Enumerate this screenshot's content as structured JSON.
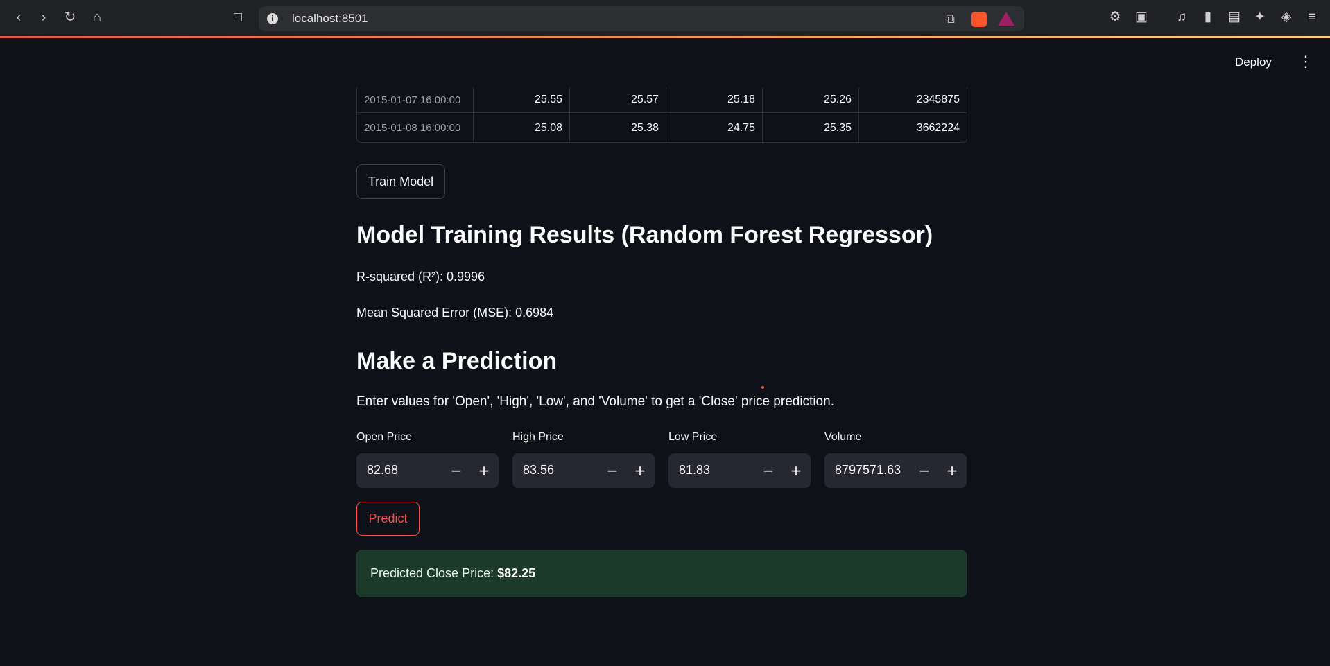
{
  "browser": {
    "url": "localhost:8501"
  },
  "header": {
    "deploy_label": "Deploy"
  },
  "table": {
    "rows": [
      {
        "index": "2015-01-07 16:00:00",
        "cells": [
          "25.55",
          "25.57",
          "25.18",
          "25.26",
          "2345875"
        ]
      },
      {
        "index": "2015-01-08 16:00:00",
        "cells": [
          "25.08",
          "25.38",
          "24.75",
          "25.35",
          "3662224"
        ]
      }
    ]
  },
  "train_button_label": "Train Model",
  "results": {
    "title": "Model Training Results (Random Forest Regressor)",
    "r2_text": "R-squared (R²): 0.9996",
    "mse_text": "Mean Squared Error (MSE): 0.6984"
  },
  "prediction": {
    "title": "Make a Prediction",
    "intro": "Enter values for 'Open', 'High', 'Low', and 'Volume' to get a 'Close' price prediction.",
    "fields": [
      {
        "label": "Open Price",
        "value": "82.68"
      },
      {
        "label": "High Price",
        "value": "83.56"
      },
      {
        "label": "Low Price",
        "value": "81.83"
      },
      {
        "label": "Volume",
        "value": "8797571.63"
      }
    ],
    "predict_button_label": "Predict",
    "result_label": "Predicted Close Price: ",
    "result_value": "$82.25"
  },
  "colors": {
    "background": "#0e1117",
    "accent": "#ff4b4b",
    "success_bg": "#1b3a2a"
  }
}
